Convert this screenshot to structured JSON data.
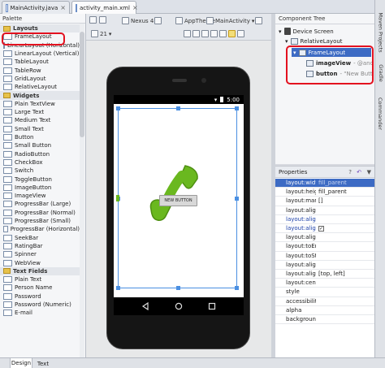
{
  "tabs": [
    {
      "label": "MainActivity.java"
    },
    {
      "label": "activity_main.xml"
    }
  ],
  "toolbar": {
    "device": "Nexus 4",
    "api": "21",
    "theme": "AppTheme",
    "activity": "MainActivity"
  },
  "palette": {
    "header": "Palette",
    "items": [
      {
        "label": "Layouts",
        "category": true
      },
      {
        "label": "FrameLayout"
      },
      {
        "label": "LinearLayout (Horizontal)"
      },
      {
        "label": "LinearLayout (Vertical)"
      },
      {
        "label": "TableLayout"
      },
      {
        "label": "TableRow"
      },
      {
        "label": "GridLayout"
      },
      {
        "label": "RelativeLayout"
      },
      {
        "label": "Widgets",
        "category": true
      },
      {
        "label": "Plain TextView"
      },
      {
        "label": "Large Text"
      },
      {
        "label": "Medium Text"
      },
      {
        "label": "Small Text"
      },
      {
        "label": "Button"
      },
      {
        "label": "Small Button"
      },
      {
        "label": "RadioButton"
      },
      {
        "label": "CheckBox"
      },
      {
        "label": "Switch"
      },
      {
        "label": "ToggleButton"
      },
      {
        "label": "ImageButton"
      },
      {
        "label": "ImageView"
      },
      {
        "label": "ProgressBar (Large)"
      },
      {
        "label": "ProgressBar (Normal)"
      },
      {
        "label": "ProgressBar (Small)"
      },
      {
        "label": "ProgressBar (Horizontal)"
      },
      {
        "label": "SeekBar"
      },
      {
        "label": "RatingBar"
      },
      {
        "label": "Spinner"
      },
      {
        "label": "WebView"
      },
      {
        "label": "Text Fields",
        "category": true
      },
      {
        "label": "Plain Text"
      },
      {
        "label": "Person Name"
      },
      {
        "label": "Password"
      },
      {
        "label": "Password (Numeric)"
      },
      {
        "label": "E-mail"
      }
    ]
  },
  "phone": {
    "time": "5:00",
    "button_label": "NEW BUTTON"
  },
  "component_tree": {
    "header": "Component Tree",
    "nodes": [
      {
        "label": "Device Screen",
        "value": ""
      },
      {
        "label": "RelativeLayout",
        "value": ""
      },
      {
        "label": "FrameLayout",
        "value": ""
      },
      {
        "label": "imageView",
        "value": "- @anc"
      },
      {
        "label": "button",
        "value": "- \"New Butt"
      }
    ]
  },
  "properties": {
    "header": "Properties",
    "rows": [
      {
        "name": "layout:width",
        "value": "fill_parent"
      },
      {
        "name": "layout:height",
        "value": "fill_parent"
      },
      {
        "name": "layout:margir",
        "value": "[]"
      },
      {
        "name": "layout:alignEr",
        "value": ""
      },
      {
        "name": "layout:alignPa",
        "value": ""
      },
      {
        "name": "layout:alignPa",
        "value": ""
      },
      {
        "name": "layout:alignSt",
        "value": ""
      },
      {
        "name": "layout:toEndC",
        "value": ""
      },
      {
        "name": "layout:toStart",
        "value": ""
      },
      {
        "name": "layout:alignPa",
        "value": ""
      },
      {
        "name": "layout:alignPa",
        "value": "[top, left]"
      },
      {
        "name": "layout:center",
        "value": ""
      },
      {
        "name": "style",
        "value": ""
      },
      {
        "name": "accessibilityLi",
        "value": ""
      },
      {
        "name": "alpha",
        "value": ""
      },
      {
        "name": "background",
        "value": ""
      }
    ]
  },
  "sidebar_right": [
    "Maven Projects",
    "Gradle",
    "Commander"
  ],
  "bottom_tabs": [
    "Design",
    "Text"
  ],
  "colors": {
    "annotation": "#e3111f",
    "selection": "#4a8fe2",
    "phone_icon": "#5fae1a"
  }
}
